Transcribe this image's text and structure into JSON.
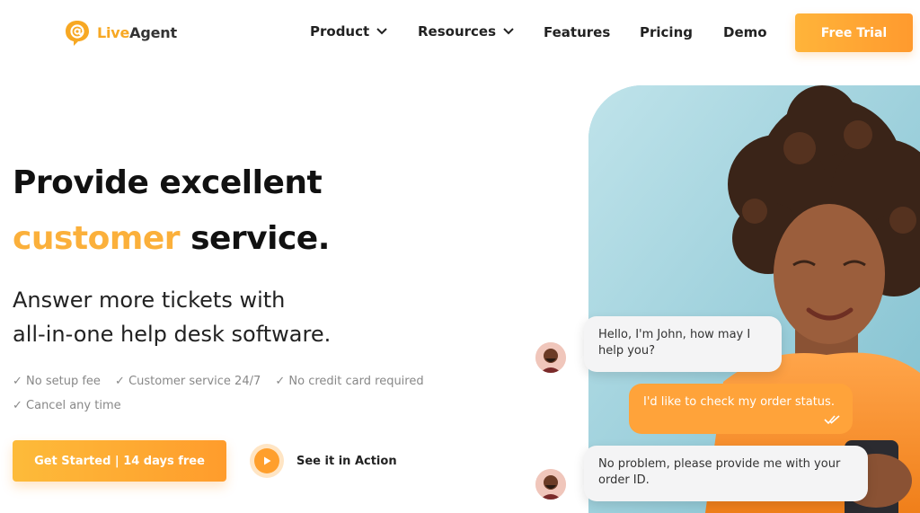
{
  "brand": {
    "part1": "Live",
    "part2": "Agent"
  },
  "nav": {
    "product": "Product",
    "resources": "Resources",
    "features": "Features",
    "pricing": "Pricing",
    "demo": "Demo"
  },
  "header_cta": "Free Trial",
  "hero": {
    "line1": "Provide excellent",
    "line2_accent": "customer",
    "line2_rest": " service.",
    "sub1": "Answer more tickets with",
    "sub2": "all-in-one help desk software.",
    "bullets": [
      "✓ No setup fee",
      "✓ Customer service 24/7",
      "✓ No credit card required",
      "✓ Cancel any time"
    ],
    "cta": "Get Started | 14 days free",
    "video_cta": "See it in Action"
  },
  "chat": {
    "agent_msg1": "Hello, I'm John, how may I help you?",
    "user_msg": "I'd like to check my order status.",
    "agent_msg2": "No problem, please provide me with your order ID."
  },
  "colors": {
    "accent": "#fbb03b",
    "button": "#ff9c2c"
  }
}
